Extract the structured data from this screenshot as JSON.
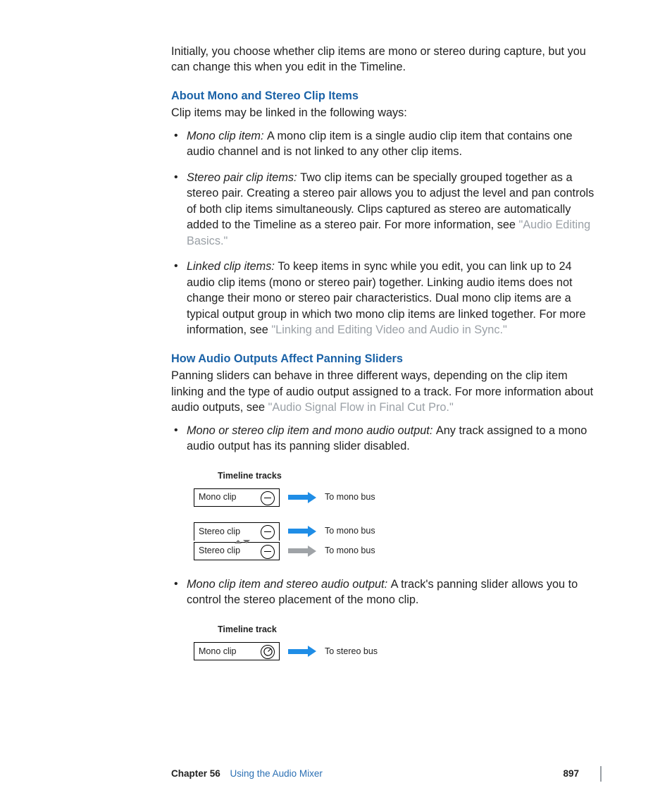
{
  "intro": "Initially, you choose whether clip items are mono or stereo during capture, but you can change this when you edit in the Timeline.",
  "sec1": {
    "title": "About Mono and Stereo Clip Items",
    "lead": "Clip items may be linked in the following ways:",
    "b1_term": "Mono clip item:  ",
    "b1": "A mono clip item is a single audio clip item that contains one audio channel and is not linked to any other clip items.",
    "b2_term": "Stereo pair clip items:  ",
    "b2a": "Two clip items can be specially grouped together as a stereo pair. Creating a stereo pair allows you to adjust the level and pan controls of both clip items simultaneously. Clips captured as stereo are automatically added to the Timeline as a stereo pair. For more information, see ",
    "b2_link": "\"Audio Editing Basics.\"",
    "b3_term": "Linked clip items:  ",
    "b3a": "To keep items in sync while you edit, you can link up to 24 audio clip items (mono or stereo pair) together. Linking audio items does not change their mono or stereo pair characteristics. Dual mono clip items are a typical output group in which two mono clip items are linked together. For more information, see ",
    "b3_link": "\"Linking and Editing Video and Audio in Sync.\""
  },
  "sec2": {
    "title": "How Audio Outputs Affect Panning Sliders",
    "lead_a": "Panning sliders can behave in three different ways, depending on the clip item linking and the type of audio output assigned to a track. For more information about audio outputs, see ",
    "lead_link": "\"Audio Signal Flow in Final Cut Pro.\"",
    "b1_term": "Mono or stereo clip item and mono audio output:  ",
    "b1": "Any track assigned to a mono audio output has its panning slider disabled.",
    "b2_term": "Mono clip item and stereo audio output:  ",
    "b2": "A track's panning slider allows you to control the stereo placement of the mono clip."
  },
  "dg1": {
    "title": "Timeline tracks",
    "row1": "Mono clip",
    "row2": "Stereo clip",
    "row3": "Stereo clip",
    "dest": "To mono bus"
  },
  "dg2": {
    "title": "Timeline track",
    "row1": "Mono clip",
    "dest": "To stereo bus"
  },
  "footer": {
    "chapter": "Chapter 56",
    "name": "Using the Audio Mixer",
    "page": "897"
  }
}
